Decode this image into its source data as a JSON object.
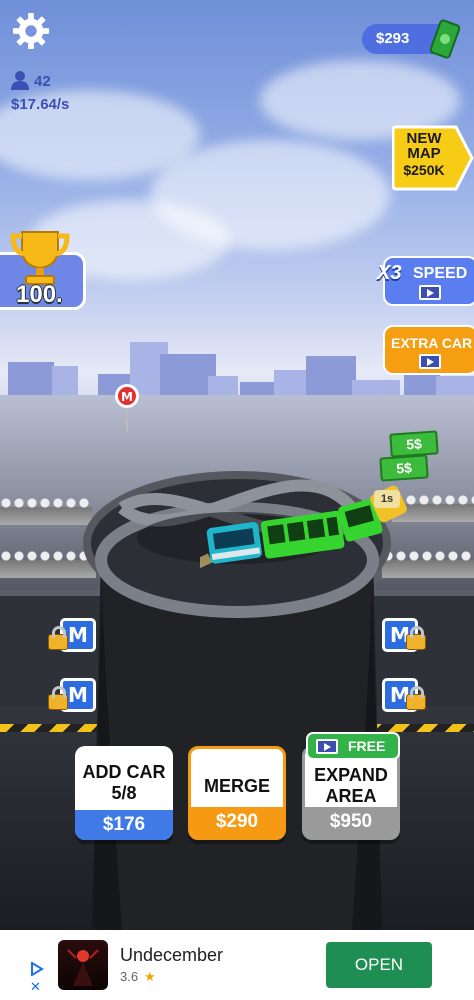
{
  "hud": {
    "money": "$293",
    "players": "42",
    "income_rate": "$17.64/s",
    "score": "100."
  },
  "offers": {
    "new_map_line1": "NEW",
    "new_map_line2": "MAP",
    "new_map_price": "$250K",
    "speed_multiplier": "X3",
    "speed_label": "SPEED",
    "extra_car_label": "EXTRA CAR"
  },
  "floating": {
    "cash_1": "5$",
    "cash_2": "5$",
    "timer": "1s",
    "station_letter": "M"
  },
  "actions": {
    "add_car_label_1": "ADD CAR",
    "add_car_label_2": "5/8",
    "add_car_price": "$176",
    "merge_label": "MERGE",
    "merge_price": "$290",
    "expand_label_1": "EXPAND",
    "expand_label_2": "AREA",
    "expand_price": "$950",
    "free_tag": "FREE"
  },
  "ad": {
    "app_name": "Undecember",
    "rating": "3.6",
    "open_label": "OPEN"
  },
  "colors": {
    "add_car_accent": "#3f7ae6",
    "merge_accent": "#f59a12",
    "expand_accent": "#9a9a9a",
    "free_tag": "#34b24a",
    "ad_open_button": "#1e8e52"
  }
}
